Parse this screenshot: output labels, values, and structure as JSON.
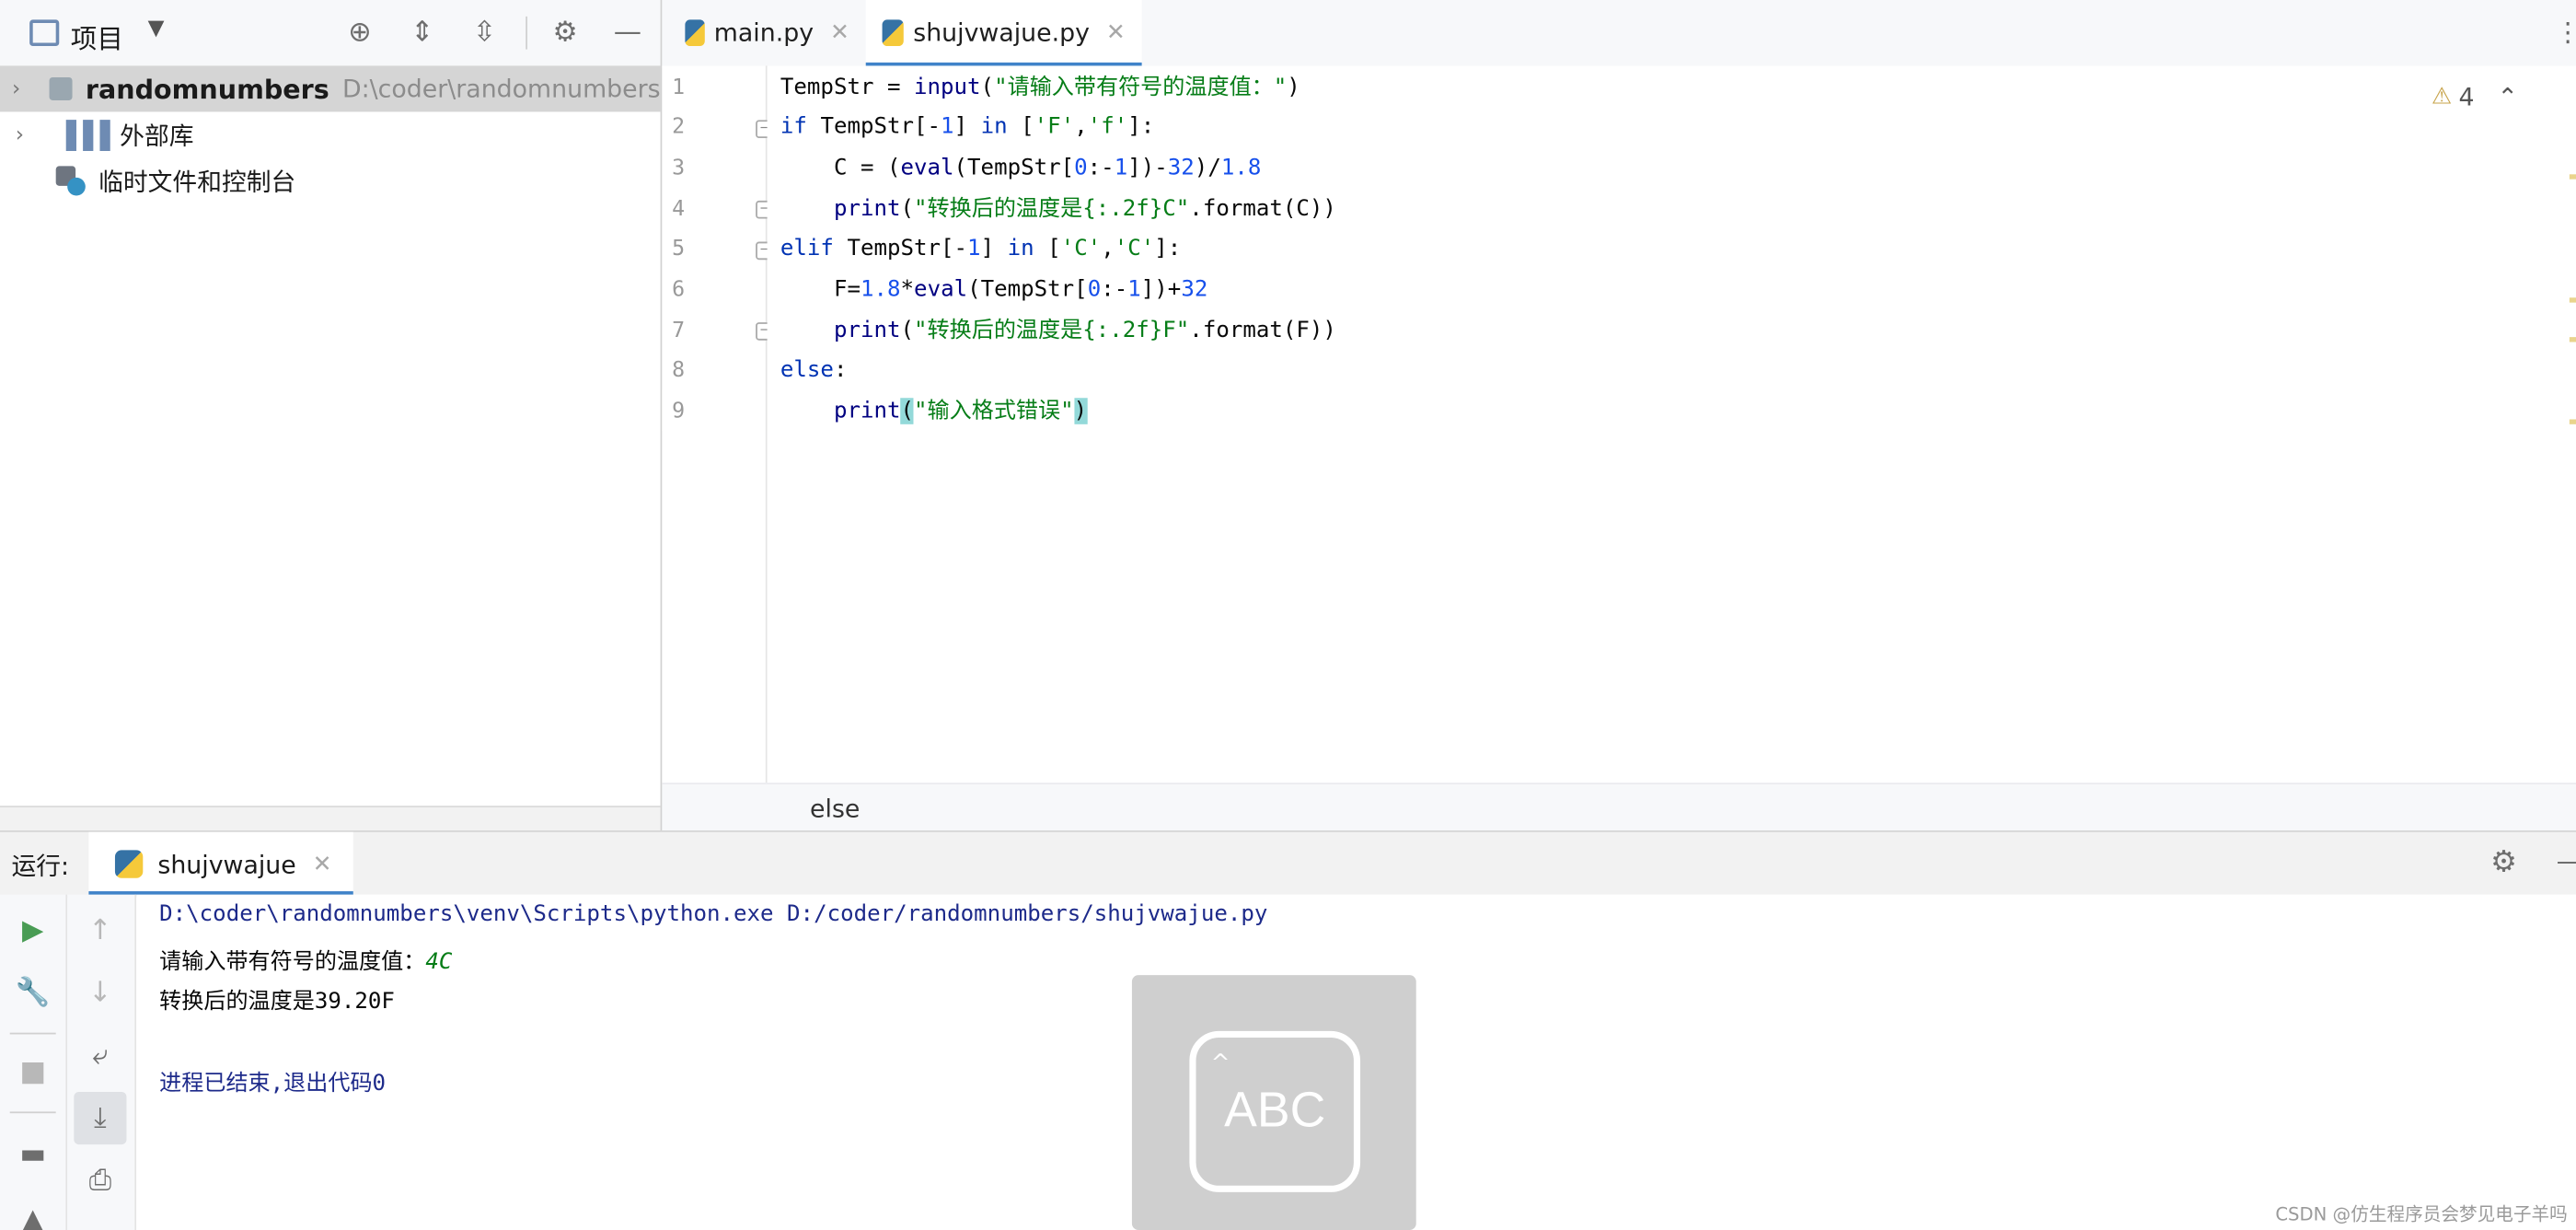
{
  "project_panel": {
    "title": "项目",
    "tree": [
      {
        "label": "randomnumbers",
        "path": "D:\\coder\\randomnumbers"
      },
      {
        "label": "外部库"
      },
      {
        "label": "临时文件和控制台"
      }
    ]
  },
  "editor": {
    "tabs": [
      {
        "label": "main.py"
      },
      {
        "label": "shujvwajue.py"
      }
    ],
    "line_numbers": [
      "1",
      "2",
      "3",
      "4",
      "5",
      "6",
      "7",
      "8",
      "9"
    ],
    "warnings_count": "4",
    "breadcrumb": "else",
    "code": {
      "l1a": "TempStr = ",
      "l1b": "input",
      "l1c": "(",
      "l1d": "\"请输入带有符号的温度值：\"",
      "l1e": ")",
      "l2a": "if",
      "l2b": " TempStr[-",
      "l2c": "1",
      "l2d": "] ",
      "l2e": "in",
      "l2f": " [",
      "l2g": "'F'",
      "l2h": ",",
      "l2i": "'f'",
      "l2j": "]:",
      "l3a": "    C = (",
      "l3b": "eval",
      "l3c": "(TempStr[",
      "l3d": "0",
      "l3e": ":-",
      "l3f": "1",
      "l3g": "])-",
      "l3h": "32",
      "l3i": ")/",
      "l3j": "1.8",
      "l4a": "    ",
      "l4b": "print",
      "l4c": "(",
      "l4d": "\"转换后的温度是{:.2f}C\"",
      "l4e": ".format(C))",
      "l5a": "elif",
      "l5b": " TempStr[-",
      "l5c": "1",
      "l5d": "] ",
      "l5e": "in",
      "l5f": " [",
      "l5g": "'C'",
      "l5h": ",",
      "l5i": "'C'",
      "l5j": "]:",
      "l6a": "    F=",
      "l6b": "1.8",
      "l6c": "*",
      "l6d": "eval",
      "l6e": "(TempStr[",
      "l6f": "0",
      "l6g": ":-",
      "l6h": "1",
      "l6i": "])+",
      "l6j": "32",
      "l7a": "    ",
      "l7b": "print",
      "l7c": "(",
      "l7d": "\"转换后的温度是{:.2f}F\"",
      "l7e": ".format(F))",
      "l8a": "else",
      "l8b": ":",
      "l9a": "    ",
      "l9b": "print",
      "l9c": "(",
      "l9d": "\"输入格式错误\"",
      "l9e": ")"
    }
  },
  "run_panel": {
    "label": "运行:",
    "tab": "shujvwajue",
    "console": {
      "command": "D:\\coder\\randomnumbers\\venv\\Scripts\\python.exe D:/coder/randomnumbers/shujvwajue.py",
      "prompt": "请输入带有符号的温度值：",
      "user_input": "4C",
      "output": "转换后的温度是39.20F",
      "exit": "进程已结束,退出代码0"
    }
  },
  "ime_overlay": {
    "text": "ABC"
  },
  "watermark": "CSDN @仿生程序员会梦见电子羊吗",
  "colors": {
    "accent": "#4083c9",
    "keyword": "#0033b3",
    "string": "#067d17",
    "number": "#1750eb",
    "run_green": "#499c54"
  }
}
